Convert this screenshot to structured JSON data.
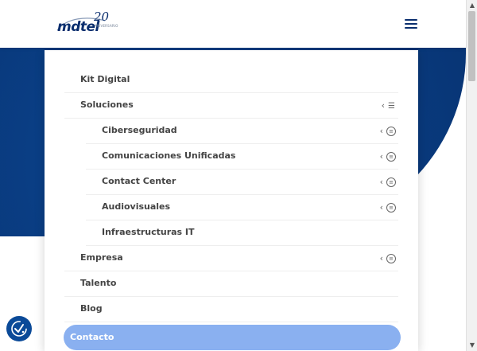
{
  "header": {
    "logo_text": "mdtel",
    "logo_anniversary": "20",
    "logo_anniversary_sub": "ANIVERSARIO",
    "menu_icon": "hamburger-icon"
  },
  "menu": {
    "items": [
      {
        "label": "Kit Digital",
        "level": 0,
        "has_submenu": false
      },
      {
        "label": "Soluciones",
        "level": 0,
        "has_submenu": true,
        "expanded": true
      },
      {
        "label": "Ciberseguridad",
        "level": 1,
        "has_submenu": true
      },
      {
        "label": "Comunicaciones Unificadas",
        "level": 1,
        "has_submenu": true
      },
      {
        "label": "Contact Center",
        "level": 1,
        "has_submenu": true
      },
      {
        "label": "Audiovisuales",
        "level": 1,
        "has_submenu": true
      },
      {
        "label": "Infraestructuras IT",
        "level": 1,
        "has_submenu": false
      },
      {
        "label": "Empresa",
        "level": 0,
        "has_submenu": true
      },
      {
        "label": "Talento",
        "level": 0,
        "has_submenu": false
      },
      {
        "label": "Blog",
        "level": 0,
        "has_submenu": false
      }
    ],
    "contacto": {
      "label": "Contacto"
    }
  },
  "colors": {
    "brand_navy": "#0a2e6e",
    "hero_blue": "#0b4a98",
    "contacto_bg": "#8ab0f0",
    "menu_text": "#444444"
  },
  "accessibility_button": {
    "icon": "accessibility-icon"
  }
}
